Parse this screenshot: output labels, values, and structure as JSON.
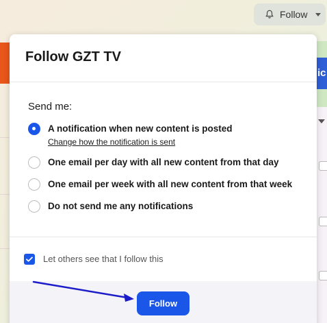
{
  "header": {
    "follow_label": "Follow",
    "bg_button_fragment": "ic"
  },
  "popup": {
    "title": "Follow GZT TV",
    "send_label": "Send me:",
    "options": [
      {
        "label": "A notification when new content is posted",
        "link": "Change how the notification is sent",
        "checked": true
      },
      {
        "label": "One email per day with all new content from that day",
        "checked": false
      },
      {
        "label": "One email per week with all new content from that week",
        "checked": false
      },
      {
        "label": "Do not send me any notifications",
        "checked": false
      }
    ],
    "visibility_label": "Let others see that I follow this",
    "follow_button": "Follow"
  },
  "colors": {
    "accent": "#1a56e8",
    "orange": "#e8561a",
    "arrow": "#1c1cc8"
  }
}
